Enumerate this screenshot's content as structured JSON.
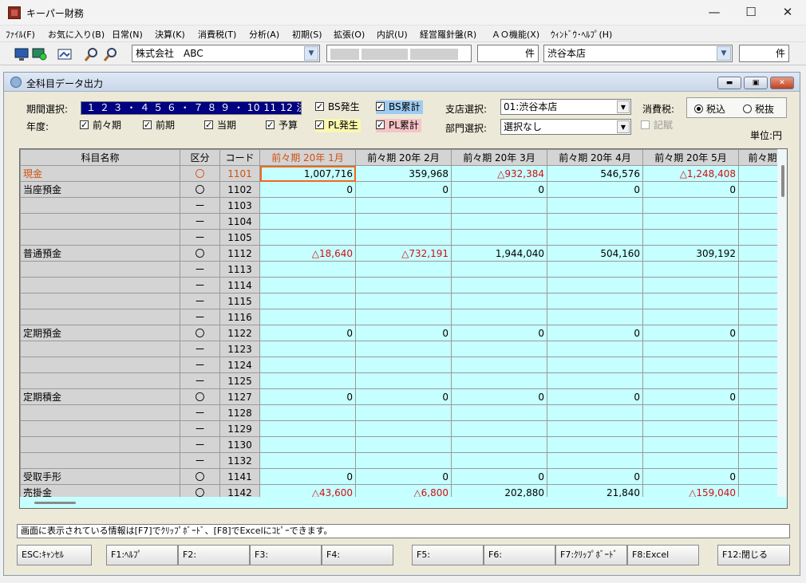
{
  "window": {
    "title": "キーパー財務",
    "controls": {
      "minimize": "—",
      "maximize": "☐",
      "close": "✕"
    }
  },
  "menu": [
    "ﾌｧｲﾙ(F)",
    "お気に入り(B)",
    "日常(N)",
    "決算(K)",
    "消費税(T)",
    "分析(A)",
    "初期(S)",
    "拡張(O)",
    "内訳(U)",
    "経営羅針盤(R)",
    "ＡＯ機能(X)",
    "ｳｨﾝﾄﾞｳ･ﾍﾙﾌﾟ(H)"
  ],
  "toolbar": {
    "company": "株式会社　ABC",
    "count1_suffix": "件",
    "branch": "渋谷本店",
    "count2_suffix": "件"
  },
  "subwindow": {
    "title": "全科目データ出力",
    "controls": {
      "minimize": "▬",
      "restore": "▣",
      "close": "✕"
    }
  },
  "filters": {
    "period_label": "期間選択:",
    "period_value": "１ ２ ３ ・ ４ ５ ６ ・ ７ ８ ９ ・ 10 11 12 決",
    "year_label": "年度:",
    "years": [
      {
        "label": "前々期",
        "checked": true
      },
      {
        "label": "前期",
        "checked": true
      },
      {
        "label": "当期",
        "checked": true
      },
      {
        "label": "予算",
        "checked": true
      }
    ],
    "bs_occur": {
      "label": "BS発生",
      "checked": true
    },
    "bs_accum": {
      "label": "BS累計",
      "checked": true
    },
    "pl_occur": {
      "label": "PL発生",
      "checked": true
    },
    "pl_accum": {
      "label": "PL累計",
      "checked": true
    },
    "branch_label": "支店選択:",
    "branch_value": "01:渋谷本店",
    "dept_label": "部門選択:",
    "dept_value": "選択なし",
    "tax_label": "消費税:",
    "tax_incl": "税込",
    "tax_excl": "税抜",
    "tax_selected": "税込",
    "kiban": {
      "label": "記賦",
      "checked": false,
      "enabled": false
    },
    "unit": "単位:円"
  },
  "grid": {
    "headers": [
      "科目名称",
      "区分",
      "コード",
      "前々期 20年 1月",
      "前々期 20年 2月",
      "前々期 20年 3月",
      "前々期 20年 4月",
      "前々期 20年 5月",
      "前々期"
    ],
    "rows": [
      {
        "name": "現金",
        "kubun": "〇",
        "code": "1101",
        "values": [
          "1,007,716",
          "359,968",
          "△932,384",
          "546,576",
          "△1,248,408",
          ""
        ]
      },
      {
        "name": "当座預金",
        "kubun": "〇",
        "code": "1102",
        "values": [
          "0",
          "0",
          "0",
          "0",
          "0",
          ""
        ]
      },
      {
        "name": "",
        "kubun": "ー",
        "code": "1103",
        "values": [
          "",
          "",
          "",
          "",
          "",
          ""
        ]
      },
      {
        "name": "",
        "kubun": "ー",
        "code": "1104",
        "values": [
          "",
          "",
          "",
          "",
          "",
          ""
        ]
      },
      {
        "name": "",
        "kubun": "ー",
        "code": "1105",
        "values": [
          "",
          "",
          "",
          "",
          "",
          ""
        ]
      },
      {
        "name": "普通預金",
        "kubun": "〇",
        "code": "1112",
        "values": [
          "△18,640",
          "△732,191",
          "1,944,040",
          "504,160",
          "309,192",
          ""
        ]
      },
      {
        "name": "",
        "kubun": "ー",
        "code": "1113",
        "values": [
          "",
          "",
          "",
          "",
          "",
          ""
        ]
      },
      {
        "name": "",
        "kubun": "ー",
        "code": "1114",
        "values": [
          "",
          "",
          "",
          "",
          "",
          ""
        ]
      },
      {
        "name": "",
        "kubun": "ー",
        "code": "1115",
        "values": [
          "",
          "",
          "",
          "",
          "",
          ""
        ]
      },
      {
        "name": "",
        "kubun": "ー",
        "code": "1116",
        "values": [
          "",
          "",
          "",
          "",
          "",
          ""
        ]
      },
      {
        "name": "定期預金",
        "kubun": "〇",
        "code": "1122",
        "values": [
          "0",
          "0",
          "0",
          "0",
          "0",
          ""
        ]
      },
      {
        "name": "",
        "kubun": "ー",
        "code": "1123",
        "values": [
          "",
          "",
          "",
          "",
          "",
          ""
        ]
      },
      {
        "name": "",
        "kubun": "ー",
        "code": "1124",
        "values": [
          "",
          "",
          "",
          "",
          "",
          ""
        ]
      },
      {
        "name": "",
        "kubun": "ー",
        "code": "1125",
        "values": [
          "",
          "",
          "",
          "",
          "",
          ""
        ]
      },
      {
        "name": "定期積金",
        "kubun": "〇",
        "code": "1127",
        "values": [
          "0",
          "0",
          "0",
          "0",
          "0",
          ""
        ]
      },
      {
        "name": "",
        "kubun": "ー",
        "code": "1128",
        "values": [
          "",
          "",
          "",
          "",
          "",
          ""
        ]
      },
      {
        "name": "",
        "kubun": "ー",
        "code": "1129",
        "values": [
          "",
          "",
          "",
          "",
          "",
          ""
        ]
      },
      {
        "name": "",
        "kubun": "ー",
        "code": "1130",
        "values": [
          "",
          "",
          "",
          "",
          "",
          ""
        ]
      },
      {
        "name": "",
        "kubun": "ー",
        "code": "1132",
        "values": [
          "",
          "",
          "",
          "",
          "",
          ""
        ]
      },
      {
        "name": "受取手形",
        "kubun": "〇",
        "code": "1141",
        "values": [
          "0",
          "0",
          "0",
          "0",
          "0",
          ""
        ]
      },
      {
        "name": "売掛金",
        "kubun": "〇",
        "code": "1142",
        "values": [
          "△43,600",
          "△6,800",
          "202,880",
          "21,840",
          "△159,040",
          ""
        ]
      }
    ]
  },
  "status": "画面に表示されている情報は[F7]でｸﾘｯﾌﾟﾎﾞｰﾄﾞ、[F8]でExcelにｺﾋﾟｰできます。",
  "fkeys": [
    "ESC:ｷｬﾝｾﾙ",
    "F1:ﾍﾙﾌﾟ",
    "F2:",
    "F3:",
    "F4:",
    "F5:",
    "F6:",
    "F7:ｸﾘｯﾌﾟﾎﾞｰﾄﾞ",
    "F8:Excel",
    "F12:閉じる"
  ],
  "colors": {
    "cell_bg": "#c6ffff",
    "negative": "#d01010",
    "current_row": "#d05010",
    "period_bg": "#000080"
  }
}
